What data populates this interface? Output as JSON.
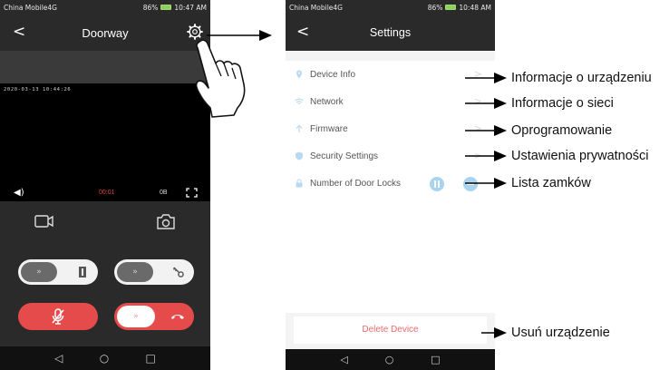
{
  "phone1": {
    "status": {
      "carrier": "China Mobile4G",
      "signal": "86%",
      "time": "10:47 AM"
    },
    "header": {
      "back_glyph": "<",
      "title": "Doorway",
      "settings_icon": "gear-icon"
    },
    "video": {
      "timestamp": "2020-03-13 10:44:26",
      "duration": "00:01",
      "quality": "0B",
      "volume_glyph": "◀)"
    },
    "controls": {
      "record_icon": "video-record-icon",
      "snapshot_icon": "camera-snapshot-icon",
      "slide1_glyph": "»",
      "slide2_glyph": "»",
      "slide3_glyph": "»"
    },
    "nav": {
      "back": "◁",
      "home": "○",
      "recent": "□"
    }
  },
  "phone2": {
    "status": {
      "carrier": "China Mobile4G",
      "signal": "86%",
      "time": "10:48 AM"
    },
    "header": {
      "back_glyph": "<",
      "title": "Settings"
    },
    "items": [
      {
        "label": "Device Info",
        "icon": "location-pin-icon"
      },
      {
        "label": "Network",
        "icon": "wifi-icon"
      },
      {
        "label": "Firmware",
        "icon": "arrow-up-icon"
      },
      {
        "label": "Security Settings",
        "icon": "shield-icon"
      },
      {
        "label": "Number of Door Locks",
        "icon": "lock-icon"
      }
    ],
    "chevron": ">",
    "delete_label": "Delete Device",
    "nav": {
      "back": "◁",
      "home": "○",
      "recent": "□"
    }
  },
  "captions": {
    "device_info": "Informacje o urządzeniu",
    "network": "Informacje o sieci",
    "firmware": "Oprogramowanie",
    "security": "Ustawienia prywatności",
    "locks": "Lista zamków",
    "delete": "Usuń urządzenie"
  },
  "colors": {
    "accent_red": "#e54b4b",
    "header_dark": "#2a2a2a",
    "lock_indicator": "#a9d4ef"
  }
}
